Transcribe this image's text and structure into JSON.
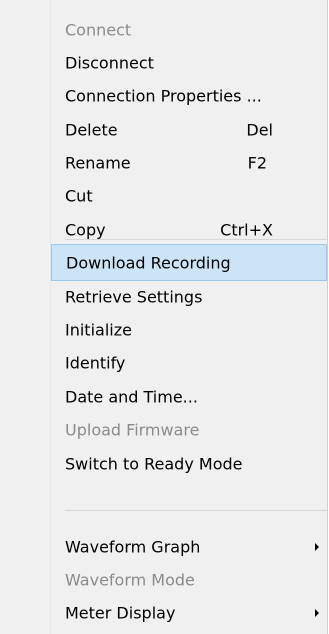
{
  "context_menu": {
    "items": [
      {
        "label": "Connect",
        "shortcut": "",
        "disabled": true,
        "highlighted": false,
        "submenu": false
      },
      {
        "label": "Disconnect",
        "shortcut": "",
        "disabled": false,
        "highlighted": false,
        "submenu": false
      },
      {
        "label": "Connection Properties ...",
        "shortcut": "",
        "disabled": false,
        "highlighted": false,
        "submenu": false
      },
      {
        "label": "Delete",
        "shortcut": "Del",
        "disabled": false,
        "highlighted": false,
        "submenu": false
      },
      {
        "label": "Rename",
        "shortcut": "F2",
        "disabled": false,
        "highlighted": false,
        "submenu": false
      },
      {
        "label": "Cut",
        "shortcut": "",
        "disabled": false,
        "highlighted": false,
        "submenu": false
      },
      {
        "label": "Copy",
        "shortcut": "Ctrl+X",
        "disabled": false,
        "highlighted": false,
        "submenu": false
      },
      {
        "label": "Download Recording",
        "shortcut": "",
        "disabled": false,
        "highlighted": true,
        "submenu": false
      },
      {
        "label": "Retrieve Settings",
        "shortcut": "",
        "disabled": false,
        "highlighted": false,
        "submenu": false
      },
      {
        "label": "Initialize",
        "shortcut": "",
        "disabled": false,
        "highlighted": false,
        "submenu": false
      },
      {
        "label": "Identify",
        "shortcut": "",
        "disabled": false,
        "highlighted": false,
        "submenu": false
      },
      {
        "label": "Date and Time...",
        "shortcut": "",
        "disabled": false,
        "highlighted": false,
        "submenu": false
      },
      {
        "label": "Upload Firmware",
        "shortcut": "",
        "disabled": true,
        "highlighted": false,
        "submenu": false
      },
      {
        "label": "Switch to Ready Mode",
        "shortcut": "",
        "disabled": false,
        "highlighted": false,
        "submenu": false
      },
      {
        "label": "Waveform Graph",
        "shortcut": "",
        "disabled": false,
        "highlighted": false,
        "submenu": true
      },
      {
        "label": "Waveform Mode",
        "shortcut": "",
        "disabled": true,
        "highlighted": false,
        "submenu": false
      },
      {
        "label": "Meter Display",
        "shortcut": "",
        "disabled": false,
        "highlighted": false,
        "submenu": true
      }
    ]
  },
  "colors": {
    "menu_background": "#f0f0f0",
    "highlight_background": "#cce4f7",
    "highlight_border": "#99c9ef",
    "disabled_text": "#8b8b8b",
    "separator": "#d7d7d7"
  },
  "icons": {
    "submenu_arrow": "submenu-arrow-icon"
  }
}
